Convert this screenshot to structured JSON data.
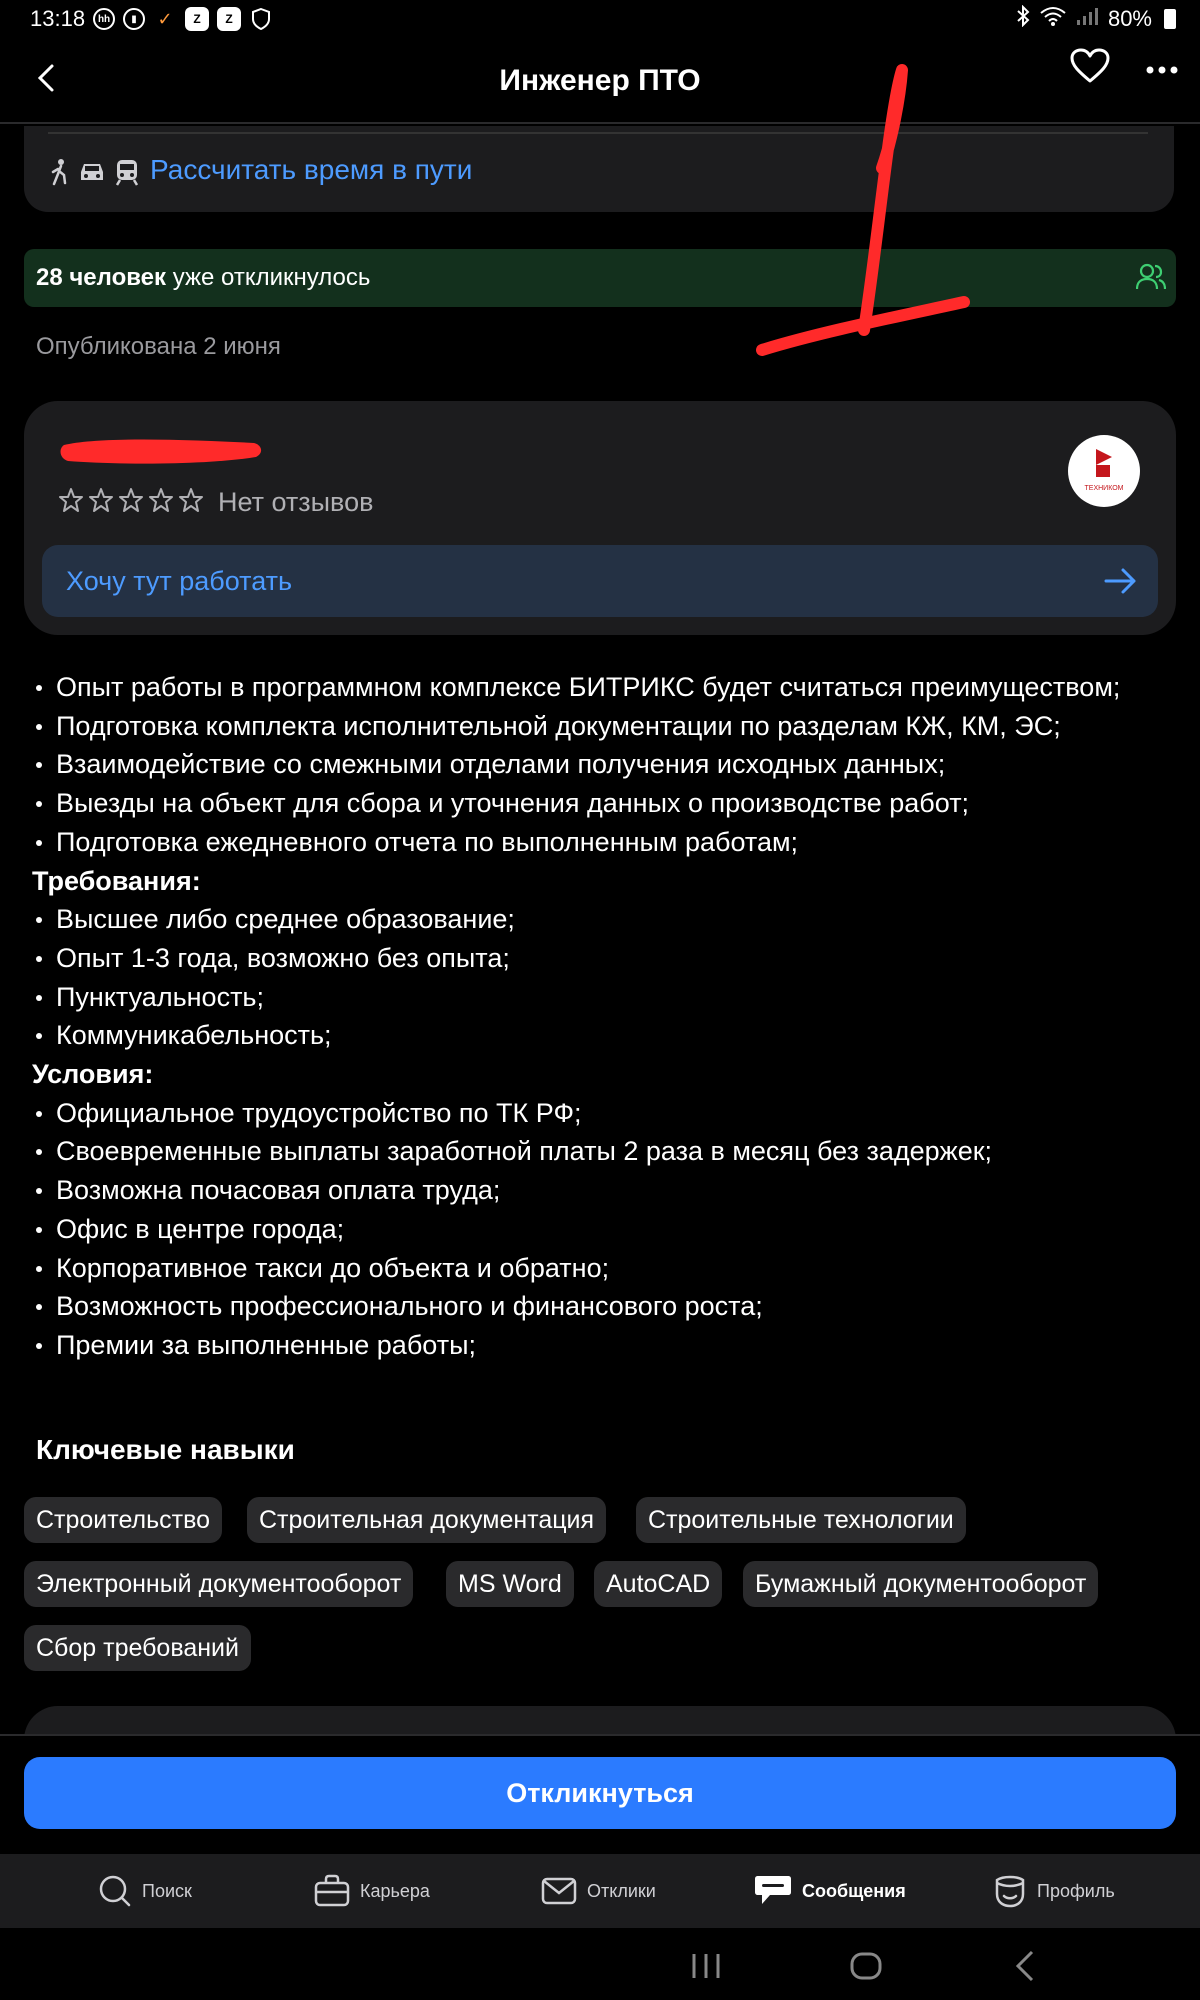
{
  "status_bar": {
    "time": "13:18",
    "battery": "80%"
  },
  "header": {
    "title": "Инженер ПТО"
  },
  "route": {
    "link_text": "Рассчитать время в пути"
  },
  "responses": {
    "count_text": "28 человек",
    "suffix": " уже откликнулось"
  },
  "published": "Опубликована 2 июня",
  "company": {
    "reviews": "Нет отзывов",
    "logo_text": "ТЕХНИКОМ",
    "want_work": "Хочу тут работать"
  },
  "description": {
    "items": [
      "Опыт работы в программном комплексе БИТРИКС будет считаться преимуществом;",
      "Подготовка комплекта исполнительной документации по разделам КЖ, КМ, ЭС;",
      "Взаимодействие со смежными отделами получения исходных данных;",
      "Выезды на объект для сбора и уточнения данных о производстве работ;",
      "Подготовка ежедневного отчета по выполненным работам;"
    ],
    "requirements_title": "Требования:",
    "requirements": [
      "Высшее либо среднее образование;",
      "Опыт 1-3 года, возможно без опыта;",
      "Пунктуальность;",
      "Коммуникабельность;"
    ],
    "conditions_title": "Условия:",
    "conditions": [
      "Официальное трудоустройство по ТК РФ;",
      "Своевременные выплаты заработной платы 2 раза в месяц без задержек;",
      "Возможна почасовая оплата труда;",
      "Офис в центре города;",
      "Корпоративное такси до объекта и обратно;",
      "Возможность профессионального и финансового роста;",
      "Премии за выполненные работы;"
    ]
  },
  "skills": {
    "title": "Ключевые навыки",
    "items": [
      "Строительство",
      "Строительная документация",
      "Строительные технологии",
      "Электронный документооборот",
      "MS Word",
      "AutoCAD",
      "Бумажный документооборот",
      "Сбор требований"
    ]
  },
  "respond_button": "Откликнуться",
  "tabs": [
    {
      "label": "Поиск",
      "icon": "search-icon"
    },
    {
      "label": "Карьера",
      "icon": "briefcase-icon"
    },
    {
      "label": "Отклики",
      "icon": "envelope-icon"
    },
    {
      "label": "Сообщения",
      "icon": "chat-icon"
    },
    {
      "label": "Профиль",
      "icon": "profile-icon"
    }
  ],
  "colors": {
    "accent": "#2b7bff",
    "link": "#4d9bff",
    "green_banner": "#13301d",
    "card": "#1c1c1e"
  }
}
